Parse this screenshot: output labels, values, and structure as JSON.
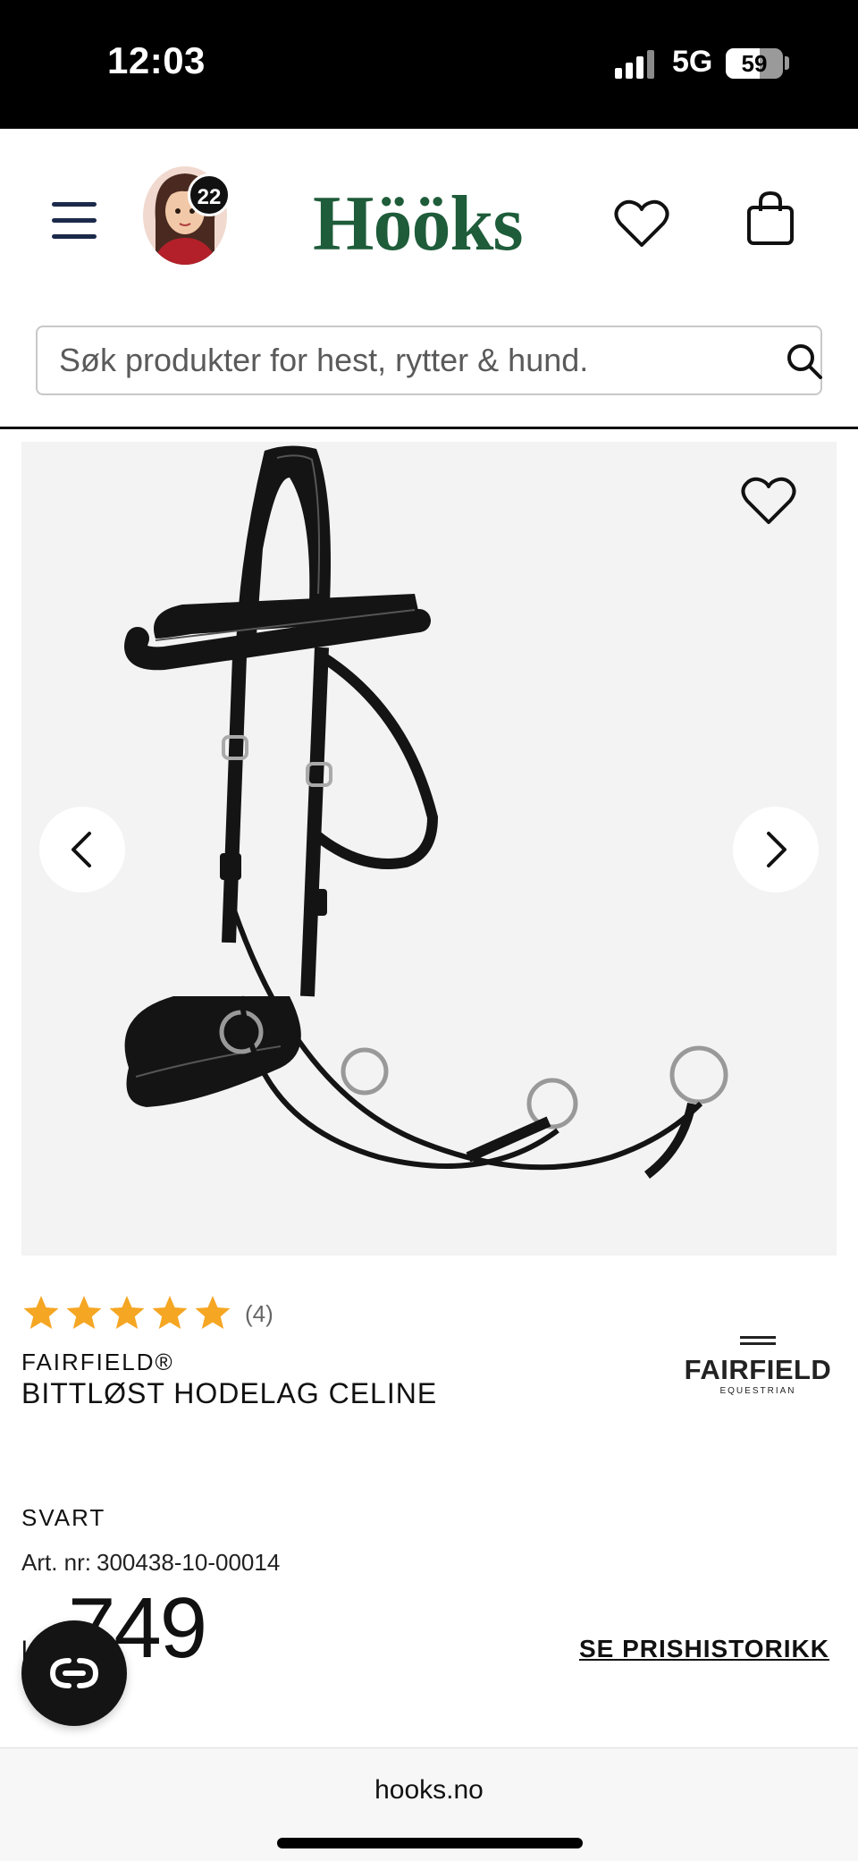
{
  "status_bar": {
    "time": "12:03",
    "network": "5G",
    "battery_level": "59",
    "battery_fraction": 0.59,
    "signal_icon": "signal-bars-icon"
  },
  "header": {
    "menu_icon": "hamburger-menu-icon",
    "avatar_badge": "22",
    "logo_text": "Hööks",
    "wishlist_icon": "heart-icon",
    "cart_icon": "shopping-bag-icon",
    "brand_color": "#1e5c3a"
  },
  "search": {
    "placeholder": "Søk produkter for hest, rytter & hund.",
    "icon": "search-icon"
  },
  "product": {
    "image_alt": "",
    "rating_value": 5,
    "rating_max": 5,
    "review_count": "(4)",
    "brand": "FAIRFIELD®",
    "title": "BITTLØST HODELAG CELINE",
    "brand_logo_name": "FAIRFIELD",
    "brand_logo_sub": "EQUESTRIAN",
    "variant": "SVART",
    "art_nr_label": "Art. nr:",
    "art_nr_value": "300438-10-00014",
    "price_prefix": "kr",
    "price": "749",
    "price_history_link": "SE PRISHISTORIKK",
    "star_color": "#f5a623"
  },
  "chat": {
    "icon": "chat-icon"
  },
  "browser": {
    "url": "hooks.no"
  }
}
